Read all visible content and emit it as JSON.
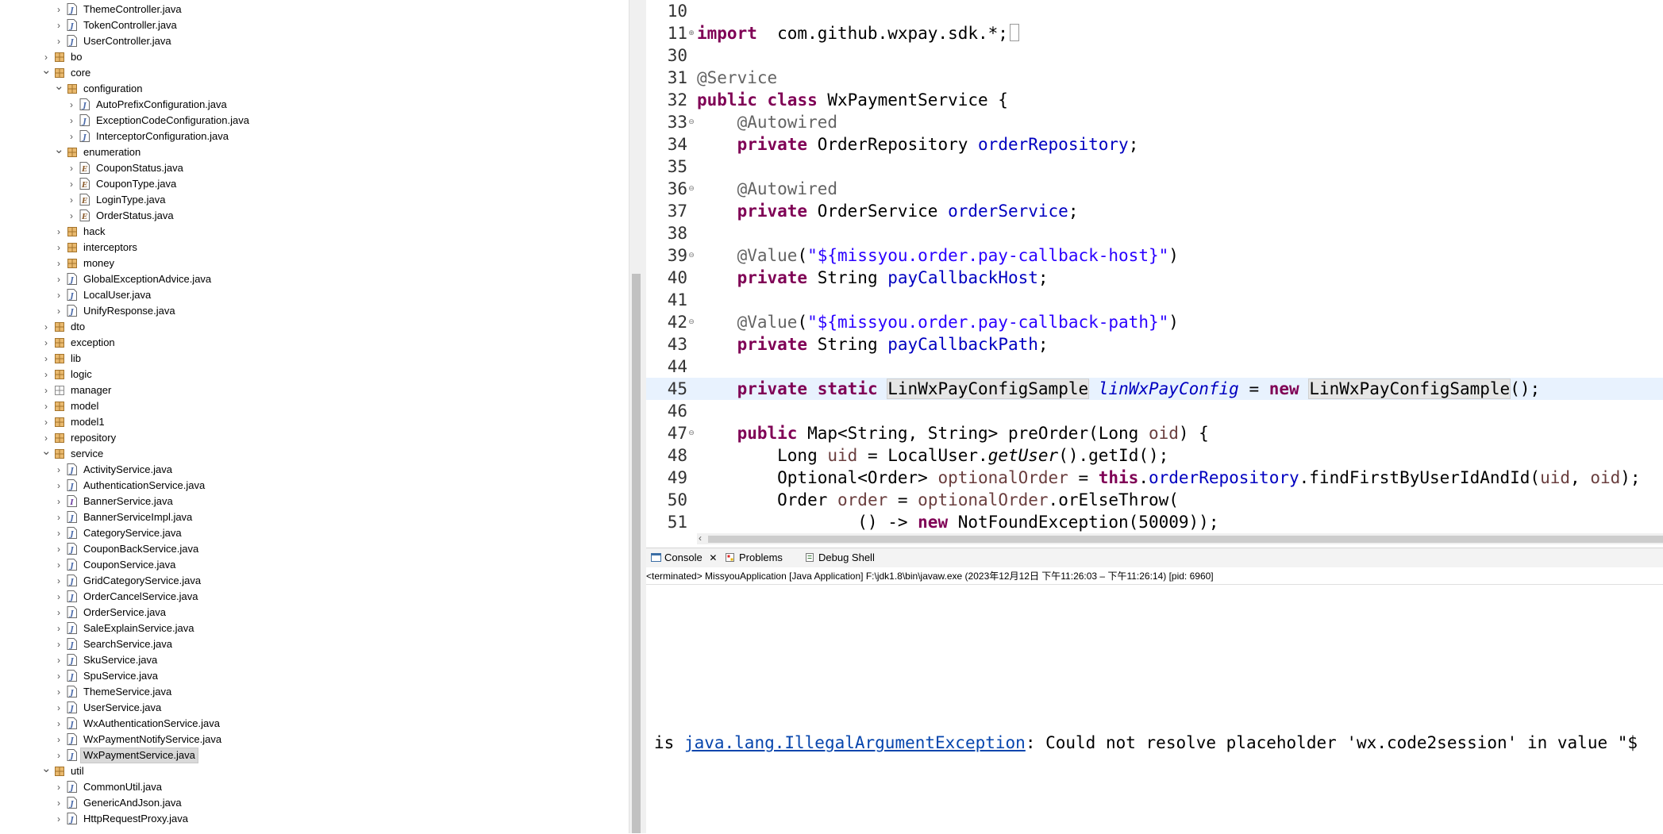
{
  "explorer": {
    "rows": [
      {
        "label": "ThemeController.java",
        "depth": 1,
        "type": "java",
        "expanded": false
      },
      {
        "label": "TokenController.java",
        "depth": 1,
        "type": "java",
        "expanded": false
      },
      {
        "label": "UserController.java",
        "depth": 1,
        "type": "java",
        "expanded": false
      },
      {
        "label": "bo",
        "depth": 0,
        "type": "package",
        "expanded": false
      },
      {
        "label": "core",
        "depth": 0,
        "type": "package",
        "expanded": true
      },
      {
        "label": "configuration",
        "depth": 1,
        "type": "package",
        "expanded": true
      },
      {
        "label": "AutoPrefixConfiguration.java",
        "depth": 2,
        "type": "java",
        "expanded": false
      },
      {
        "label": "ExceptionCodeConfiguration.java",
        "depth": 2,
        "type": "java",
        "expanded": false
      },
      {
        "label": "InterceptorConfiguration.java",
        "depth": 2,
        "type": "java",
        "expanded": false
      },
      {
        "label": "enumeration",
        "depth": 1,
        "type": "package",
        "expanded": true
      },
      {
        "label": "CouponStatus.java",
        "depth": 2,
        "type": "enum",
        "expanded": false
      },
      {
        "label": "CouponType.java",
        "depth": 2,
        "type": "enum",
        "expanded": false
      },
      {
        "label": "LoginType.java",
        "depth": 2,
        "type": "enum",
        "expanded": false
      },
      {
        "label": "OrderStatus.java",
        "depth": 2,
        "type": "enum",
        "expanded": false
      },
      {
        "label": "hack",
        "depth": 1,
        "type": "package",
        "expanded": false
      },
      {
        "label": "interceptors",
        "depth": 1,
        "type": "package",
        "expanded": false
      },
      {
        "label": "money",
        "depth": 1,
        "type": "package",
        "expanded": false
      },
      {
        "label": "GlobalExceptionAdvice.java",
        "depth": 1,
        "type": "java",
        "expanded": false
      },
      {
        "label": "LocalUser.java",
        "depth": 1,
        "type": "java",
        "expanded": false
      },
      {
        "label": "UnifyResponse.java",
        "depth": 1,
        "type": "java",
        "expanded": false
      },
      {
        "label": "dto",
        "depth": 0,
        "type": "package",
        "expanded": false
      },
      {
        "label": "exception",
        "depth": 0,
        "type": "package",
        "expanded": false
      },
      {
        "label": "lib",
        "depth": 0,
        "type": "package",
        "expanded": false
      },
      {
        "label": "logic",
        "depth": 0,
        "type": "package",
        "expanded": false
      },
      {
        "label": "manager",
        "depth": 0,
        "type": "package-empty",
        "expanded": false
      },
      {
        "label": "model",
        "depth": 0,
        "type": "package",
        "expanded": false
      },
      {
        "label": "model1",
        "depth": 0,
        "type": "package",
        "expanded": false
      },
      {
        "label": "repository",
        "depth": 0,
        "type": "package",
        "expanded": false
      },
      {
        "label": "service",
        "depth": 0,
        "type": "package",
        "expanded": true
      },
      {
        "label": "ActivityService.java",
        "depth": 1,
        "type": "java",
        "expanded": false
      },
      {
        "label": "AuthenticationService.java",
        "depth": 1,
        "type": "java",
        "expanded": false
      },
      {
        "label": "BannerService.java",
        "depth": 1,
        "type": "interface",
        "expanded": false
      },
      {
        "label": "BannerServiceImpl.java",
        "depth": 1,
        "type": "java",
        "expanded": false
      },
      {
        "label": "CategoryService.java",
        "depth": 1,
        "type": "java",
        "expanded": false
      },
      {
        "label": "CouponBackService.java",
        "depth": 1,
        "type": "java",
        "expanded": false
      },
      {
        "label": "CouponService.java",
        "depth": 1,
        "type": "java",
        "expanded": false
      },
      {
        "label": "GridCategoryService.java",
        "depth": 1,
        "type": "java",
        "expanded": false
      },
      {
        "label": "OrderCancelService.java",
        "depth": 1,
        "type": "java",
        "expanded": false
      },
      {
        "label": "OrderService.java",
        "depth": 1,
        "type": "java",
        "expanded": false
      },
      {
        "label": "SaleExplainService.java",
        "depth": 1,
        "type": "java",
        "expanded": false
      },
      {
        "label": "SearchService.java",
        "depth": 1,
        "type": "java",
        "expanded": false
      },
      {
        "label": "SkuService.java",
        "depth": 1,
        "type": "java",
        "expanded": false
      },
      {
        "label": "SpuService.java",
        "depth": 1,
        "type": "java",
        "expanded": false
      },
      {
        "label": "ThemeService.java",
        "depth": 1,
        "type": "java",
        "expanded": false
      },
      {
        "label": "UserService.java",
        "depth": 1,
        "type": "java",
        "expanded": false
      },
      {
        "label": "WxAuthenticationService.java",
        "depth": 1,
        "type": "java",
        "expanded": false
      },
      {
        "label": "WxPaymentNotifyService.java",
        "depth": 1,
        "type": "java",
        "expanded": false
      },
      {
        "label": "WxPaymentService.java",
        "depth": 1,
        "type": "java",
        "expanded": false,
        "selected": true
      },
      {
        "label": "util",
        "depth": 0,
        "type": "package",
        "expanded": true
      },
      {
        "label": "CommonUtil.java",
        "depth": 1,
        "type": "java",
        "expanded": false
      },
      {
        "label": "GenericAndJson.java",
        "depth": 1,
        "type": "java",
        "expanded": false
      },
      {
        "label": "HttpRequestProxy.java",
        "depth": 1,
        "type": "java",
        "expanded": false
      }
    ]
  },
  "editor": {
    "lines": [
      {
        "n": "10",
        "fold": "",
        "tokens": []
      },
      {
        "n": "11",
        "fold": "+",
        "tokens": [
          [
            "kw",
            "import"
          ],
          [
            "",
            "  com.github.wxpay.sdk.*;"
          ],
          [
            "box",
            " "
          ]
        ]
      },
      {
        "n": "30",
        "fold": "",
        "tokens": []
      },
      {
        "n": "31",
        "fold": "",
        "tokens": [
          [
            "an",
            "@Service"
          ]
        ]
      },
      {
        "n": "32",
        "fold": "",
        "tokens": [
          [
            "kw",
            "public"
          ],
          [
            "",
            " "
          ],
          [
            "kw",
            "class"
          ],
          [
            "",
            " WxPaymentService {"
          ]
        ]
      },
      {
        "n": "33",
        "fold": "-",
        "tokens": [
          [
            "",
            " "
          ],
          [
            "an",
            "@Autowired"
          ]
        ]
      },
      {
        "n": "34",
        "fold": "",
        "tokens": [
          [
            "",
            " "
          ],
          [
            "kw",
            "private"
          ],
          [
            "",
            " OrderRepository "
          ],
          [
            "fd",
            "orderRepository"
          ],
          [
            "",
            ";"
          ]
        ]
      },
      {
        "n": "35",
        "fold": "",
        "tokens": []
      },
      {
        "n": "36",
        "fold": "-",
        "tokens": [
          [
            "",
            " "
          ],
          [
            "an",
            "@Autowired"
          ]
        ]
      },
      {
        "n": "37",
        "fold": "",
        "tokens": [
          [
            "",
            " "
          ],
          [
            "kw",
            "private"
          ],
          [
            "",
            " OrderService "
          ],
          [
            "fd",
            "orderService"
          ],
          [
            "",
            ";"
          ]
        ]
      },
      {
        "n": "38",
        "fold": "",
        "tokens": []
      },
      {
        "n": "39",
        "fold": "-",
        "tokens": [
          [
            "",
            " "
          ],
          [
            "an",
            "@Value"
          ],
          [
            "",
            "("
          ],
          [
            "st",
            "\"${missyou.order.pay-callback-host}\""
          ],
          [
            "",
            ")"
          ]
        ]
      },
      {
        "n": "40",
        "fold": "",
        "tokens": [
          [
            "",
            " "
          ],
          [
            "kw",
            "private"
          ],
          [
            "",
            " String "
          ],
          [
            "fd",
            "payCallbackHost"
          ],
          [
            "",
            ";"
          ]
        ]
      },
      {
        "n": "41",
        "fold": "",
        "tokens": []
      },
      {
        "n": "42",
        "fold": "-",
        "tokens": [
          [
            "",
            " "
          ],
          [
            "an",
            "@Value"
          ],
          [
            "",
            "("
          ],
          [
            "st",
            "\"${missyou.order.pay-callback-path}\""
          ],
          [
            "",
            ")"
          ]
        ]
      },
      {
        "n": "43",
        "fold": "",
        "tokens": [
          [
            "",
            " "
          ],
          [
            "kw",
            "private"
          ],
          [
            "",
            " String "
          ],
          [
            "fd",
            "payCallbackPath"
          ],
          [
            "",
            ";"
          ]
        ]
      },
      {
        "n": "44",
        "fold": "",
        "tokens": []
      },
      {
        "n": "45",
        "fold": "",
        "current": true,
        "tokens": [
          [
            "",
            " "
          ],
          [
            "kw",
            "private"
          ],
          [
            "",
            " "
          ],
          [
            "kw",
            "static"
          ],
          [
            "",
            " "
          ],
          [
            "occ",
            "LinWxPayConfigSample"
          ],
          [
            "",
            " "
          ],
          [
            "fdi",
            "linWxPayConfig"
          ],
          [
            "",
            " = "
          ],
          [
            "kw",
            "new"
          ],
          [
            "",
            " "
          ],
          [
            "occ",
            "LinWxPayConfigSample"
          ],
          [
            "",
            "("
          ],
          [
            "",
            ")"
          ],
          [
            "",
            ";"
          ]
        ]
      },
      {
        "n": "46",
        "fold": "",
        "tokens": []
      },
      {
        "n": "47",
        "fold": "-",
        "tokens": [
          [
            "",
            " "
          ],
          [
            "kw",
            "public"
          ],
          [
            "",
            " Map<String, String> preOrder(Long "
          ],
          [
            "lv",
            "oid"
          ],
          [
            "",
            ") {"
          ]
        ]
      },
      {
        "n": "48",
        "fold": "",
        "tokens": [
          [
            "",
            " Long "
          ],
          [
            "lv",
            "uid"
          ],
          [
            "",
            " = LocalUser."
          ],
          [
            "it",
            "getUser"
          ],
          [
            "",
            "().getId();"
          ]
        ]
      },
      {
        "n": "49",
        "fold": "",
        "tokens": [
          [
            "",
            " Optional<Order> "
          ],
          [
            "lv",
            "optionalOrder"
          ],
          [
            "",
            " = "
          ],
          [
            "kw",
            "this"
          ],
          [
            "",
            "."
          ],
          [
            "fd",
            "orderRepository"
          ],
          [
            "",
            ".findFirstByUserIdAndId("
          ],
          [
            "lv",
            "uid"
          ],
          [
            "",
            ", "
          ],
          [
            "lv",
            "oid"
          ],
          [
            "",
            ");"
          ]
        ]
      },
      {
        "n": "50",
        "fold": "",
        "tokens": [
          [
            "",
            " Order "
          ],
          [
            "lv",
            "order"
          ],
          [
            "",
            " = "
          ],
          [
            "lv",
            "optionalOrder"
          ],
          [
            "",
            ".orElseThrow("
          ]
        ]
      },
      {
        "n": "51",
        "fold": "",
        "tokens": [
          [
            "",
            " () -> "
          ],
          [
            "kw",
            "new"
          ],
          [
            "",
            " NotFoundException(50009));"
          ]
        ]
      }
    ]
  },
  "console": {
    "tabs": [
      "Console",
      "Problems",
      "Debug Shell"
    ],
    "status": "<terminated> MissyouApplication [Java Application] F:\\jdk1.8\\bin\\javaw.exe  (2023年12月12日 下午11:26:03 – 下午11:26:14) [pid: 6960]",
    "output_prefix": "is ",
    "output_link": "java.lang.IllegalArgumentException",
    "output_rest": ": Could not resolve placeholder 'wx.code2session' in value \"$"
  }
}
